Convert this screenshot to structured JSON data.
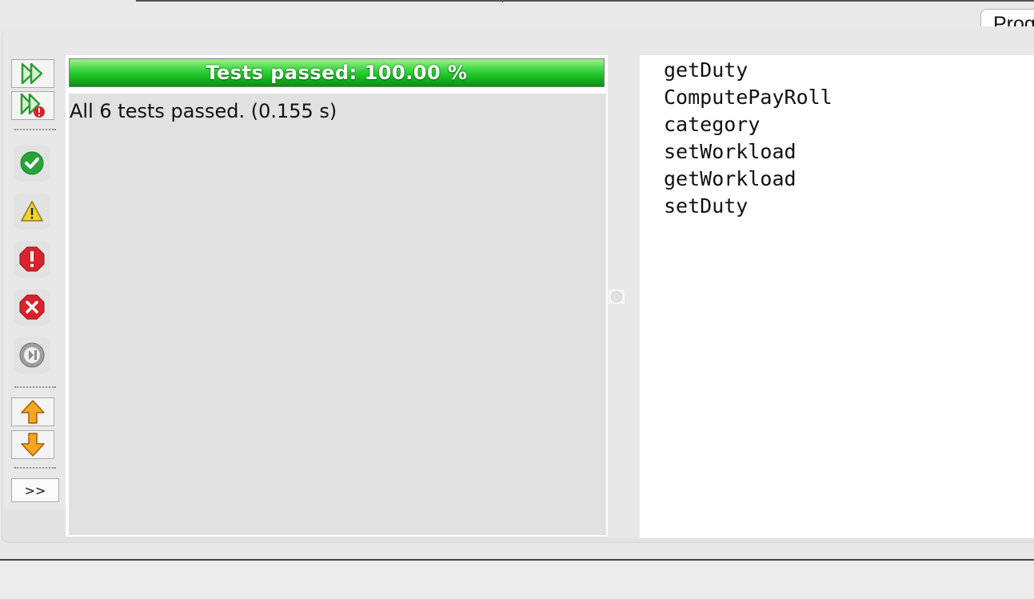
{
  "top_tab": {
    "label": "Prog"
  },
  "toolbar": {
    "rerun_label": "rerun-icon",
    "rerun_failed_label": "rerun-failed-icon",
    "filters": [
      {
        "icon": "passed-icon",
        "color": "#2aa43a"
      },
      {
        "icon": "warning-icon",
        "color": "#f2d22c"
      },
      {
        "icon": "error-icon",
        "color": "#d9222c"
      },
      {
        "icon": "failure-icon",
        "color": "#d9222c"
      },
      {
        "icon": "skipped-icon",
        "color": "#9e9e9e"
      }
    ],
    "more_label": ">>"
  },
  "results": {
    "progress_text": "Tests passed: 100.00 %",
    "progress_fraction": 1.0,
    "progress_color": "#22c22a",
    "summary": "All 6 tests passed. (0.155 s)"
  },
  "methods": [
    "getDuty",
    "ComputePayRoll",
    "category",
    "setWorkload",
    "getWorkload",
    "setDuty"
  ]
}
